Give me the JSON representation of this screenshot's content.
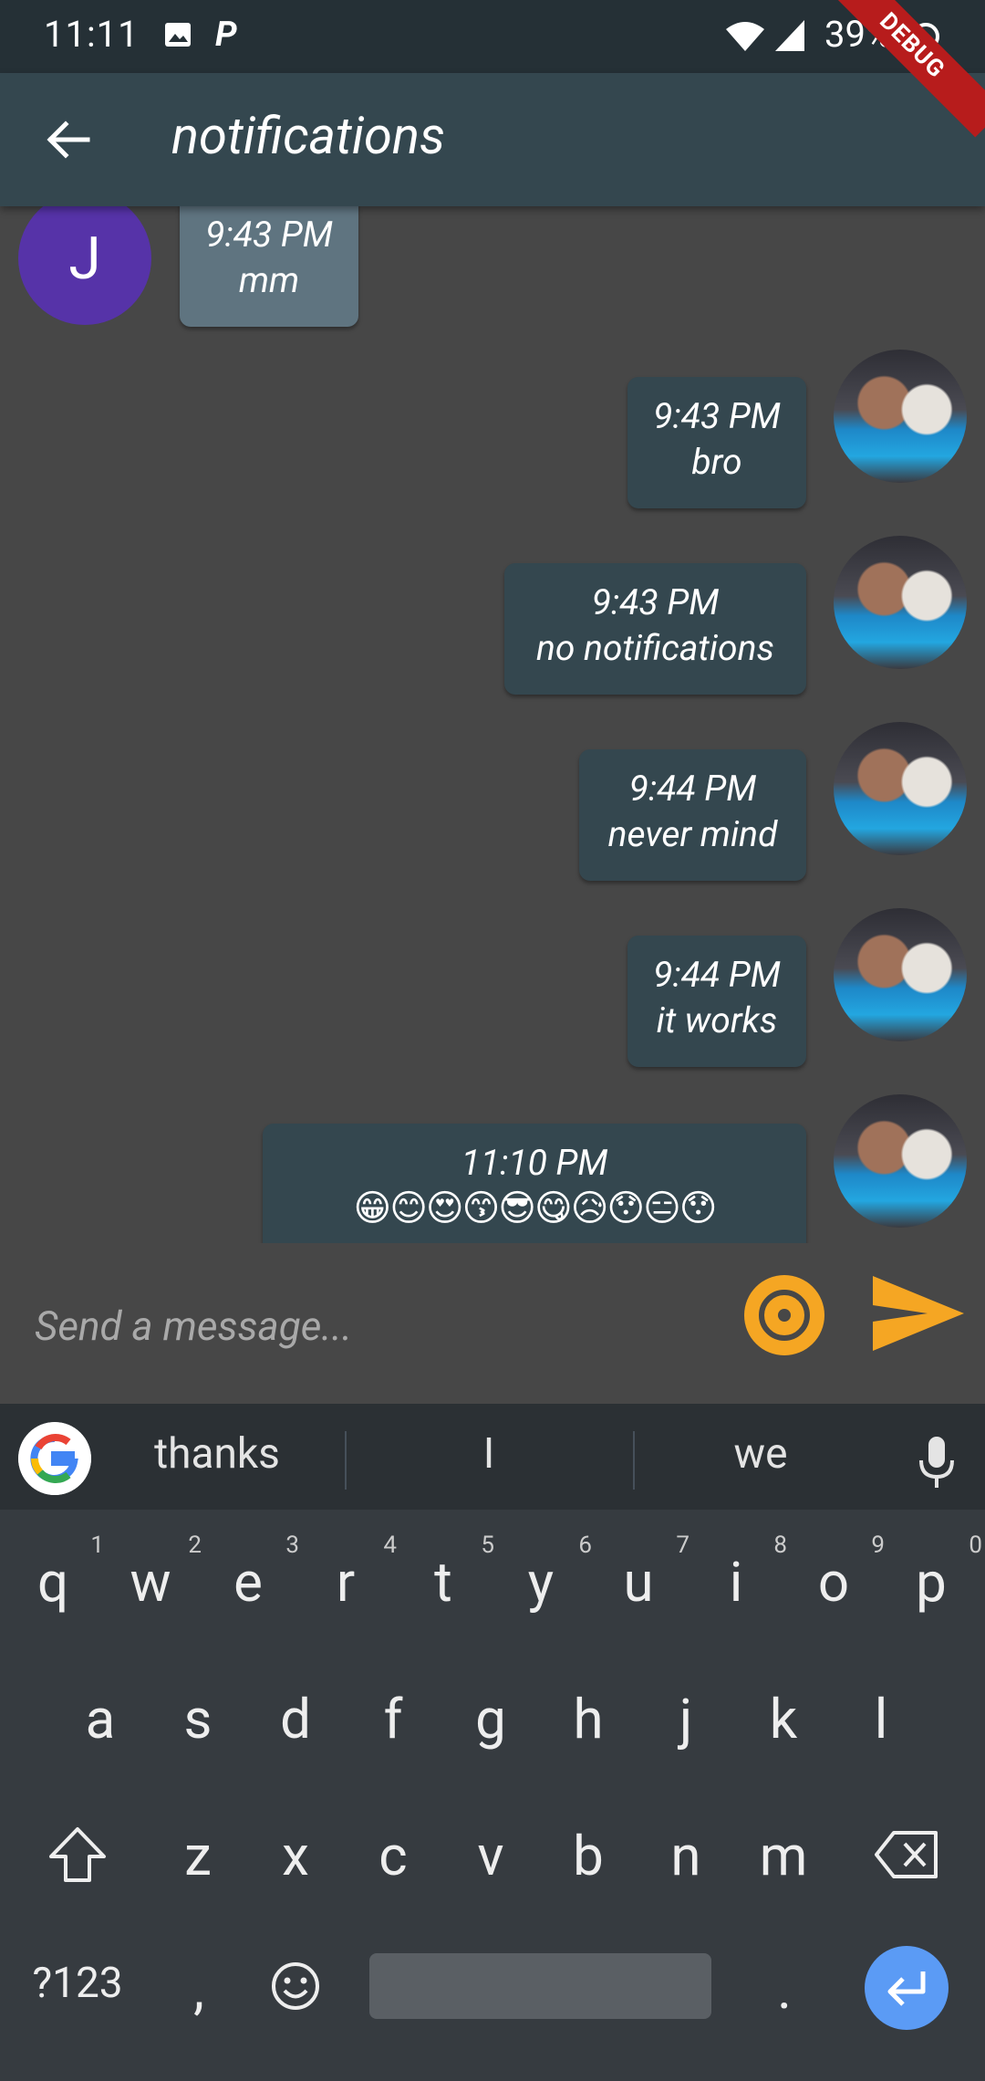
{
  "status_bar": {
    "time": "11:11",
    "battery": "39%"
  },
  "debug_banner": "DEBUG",
  "app_bar": {
    "title": "notifications"
  },
  "messages": [
    {
      "side": "theirs",
      "avatar": "J",
      "time": "9:43 PM",
      "text": "mm"
    },
    {
      "side": "mine",
      "time": "9:43 PM",
      "text": "bro"
    },
    {
      "side": "mine",
      "time": "9:43 PM",
      "text": "no notifications"
    },
    {
      "side": "mine",
      "time": "9:44 PM",
      "text": "never mind"
    },
    {
      "side": "mine",
      "time": "9:44 PM",
      "text": "it works"
    },
    {
      "side": "mine",
      "time": "11:10 PM",
      "text": "😁😊😍😙😎😋😥😯😑😯"
    }
  ],
  "input": {
    "placeholder": "Send a message..."
  },
  "keyboard": {
    "suggestions": [
      "thanks",
      "I",
      "we"
    ],
    "row1": [
      [
        "q",
        "1"
      ],
      [
        "w",
        "2"
      ],
      [
        "e",
        "3"
      ],
      [
        "r",
        "4"
      ],
      [
        "t",
        "5"
      ],
      [
        "y",
        "6"
      ],
      [
        "u",
        "7"
      ],
      [
        "i",
        "8"
      ],
      [
        "o",
        "9"
      ],
      [
        "p",
        "0"
      ]
    ],
    "row2": [
      "a",
      "s",
      "d",
      "f",
      "g",
      "h",
      "j",
      "k",
      "l"
    ],
    "row3": [
      "z",
      "x",
      "c",
      "v",
      "b",
      "n",
      "m"
    ],
    "symbols_label": "?123",
    "comma": ",",
    "period": "."
  },
  "colors": {
    "accent": "#f5a623",
    "appbar": "#34474f",
    "background": "#474747",
    "avatar_letter_bg": "#5633a8",
    "enter_key": "#5b9bf5"
  }
}
